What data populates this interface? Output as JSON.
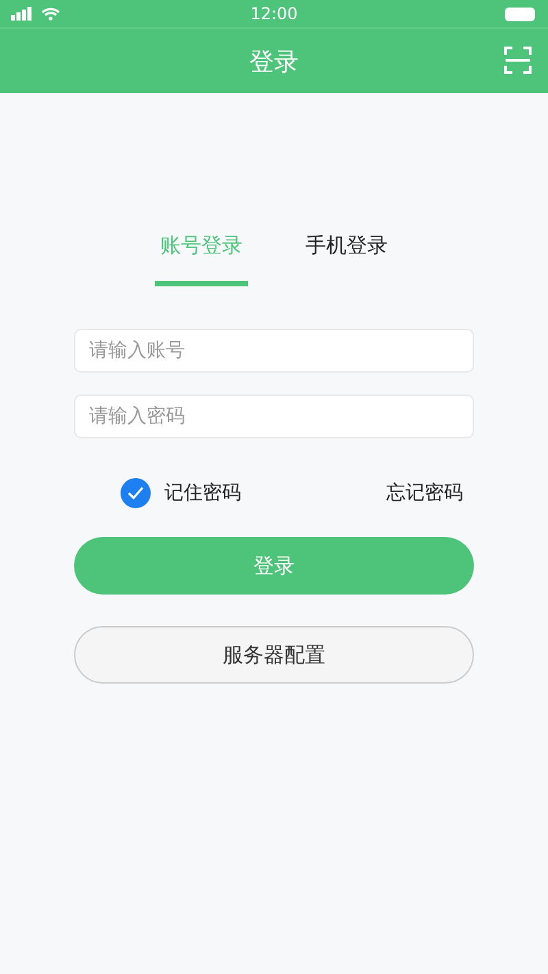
{
  "status_bar": {
    "time": "12:00"
  },
  "nav": {
    "title": "登录"
  },
  "tabs": [
    {
      "label": "账号登录",
      "selected": true
    },
    {
      "label": "手机登录",
      "selected": false
    }
  ],
  "fields": [
    {
      "placeholder": "请输入账号"
    },
    {
      "placeholder": "请输入密码"
    }
  ],
  "remember": {
    "label": "记住密码",
    "checked": true
  },
  "forgot": {
    "label": "忘记密码"
  },
  "buttons": [
    {
      "label": "登录",
      "kind": "primary"
    },
    {
      "label": "服务器配置",
      "kind": "secondary"
    }
  ]
}
